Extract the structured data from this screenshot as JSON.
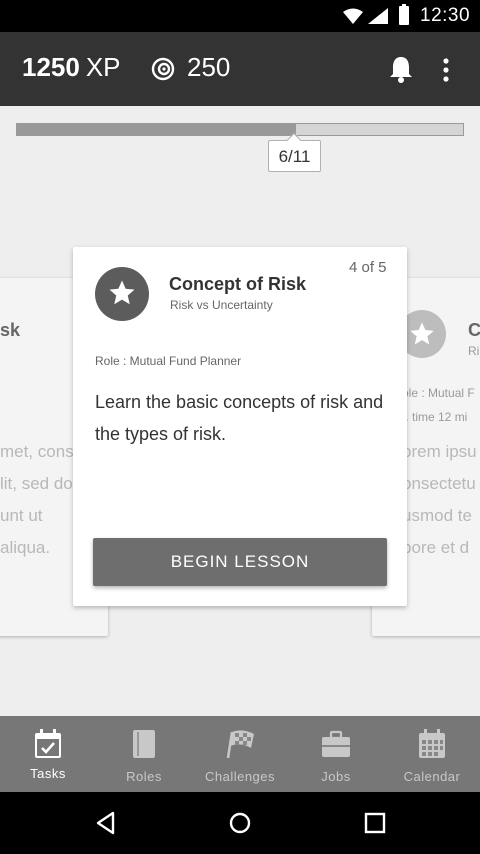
{
  "status_bar": {
    "time": "12:30",
    "icons": [
      "wifi-icon",
      "signal-icon",
      "battery-icon"
    ]
  },
  "app_bar": {
    "xp_value": "1250",
    "xp_unit": "XP",
    "coins": "250",
    "icons": [
      "coin-icon",
      "bell-icon",
      "more-vert-icon"
    ]
  },
  "progress": {
    "label": "6/11",
    "current": 6,
    "total": 11,
    "fraction": 0.625
  },
  "left_card": {
    "title": "sk",
    "body": [
      "met, cons",
      "lit, sed do",
      "unt ut",
      "aliqua."
    ]
  },
  "main_card": {
    "title": "Concept of Risk",
    "subtitle": "Risk vs Uncertainty",
    "counter": "4 of 5",
    "role": "Role : Mutual Fund Planner",
    "description": "Learn the basic concepts of risk and the types of risk.",
    "button": "BEGIN LESSON",
    "icon": "star-icon"
  },
  "right_card": {
    "title": "C",
    "subtitle": "Ri",
    "role": "ole : Mutual F",
    "time": "t. time 12 mi",
    "body": [
      "orem ipsu",
      "onsectetu",
      "usmod te",
      "bore et d"
    ]
  },
  "bottom_nav": {
    "items": [
      {
        "label": "Tasks",
        "icon": "calendar-check-icon",
        "active": true
      },
      {
        "label": "Roles",
        "icon": "book-icon",
        "active": false
      },
      {
        "label": "Challenges",
        "icon": "checkered-flag-icon",
        "active": false
      },
      {
        "label": "Jobs",
        "icon": "briefcase-icon",
        "active": false
      },
      {
        "label": "Calendar",
        "icon": "calendar-icon",
        "active": false
      }
    ]
  },
  "system_nav": {
    "icons": [
      "back-icon",
      "home-icon",
      "recents-icon"
    ]
  },
  "colors": {
    "app_bar": "#333333",
    "card_icon": "#5c5c5c",
    "button": "#6e6e6e",
    "bottom_nav": "#777777",
    "background": "#eeeeee"
  }
}
